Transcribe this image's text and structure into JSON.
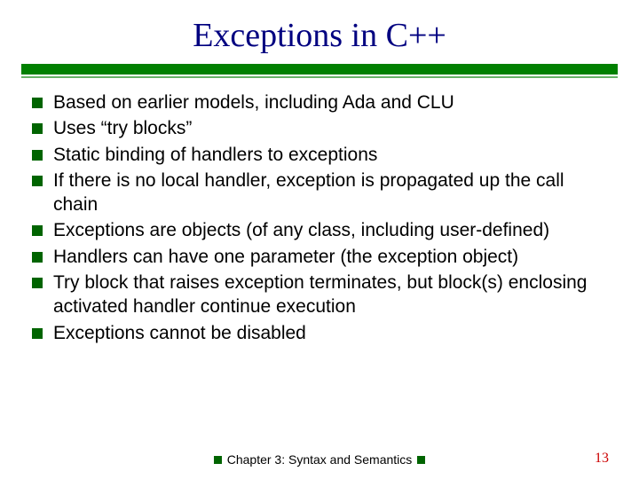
{
  "title": "Exceptions in C++",
  "bullets": [
    "Based on earlier models, including Ada and CLU",
    "Uses “try blocks”",
    "Static binding of handlers to exceptions",
    "If there is no local handler, exception is propagated up the call chain",
    "Exceptions are objects (of any class, including user-defined)",
    "Handlers can have one parameter (the exception object)",
    "Try block that raises exception terminates, but block(s) enclosing activated handler continue execution",
    "Exceptions cannot be disabled"
  ],
  "footer": "Chapter 3: Syntax and Semantics",
  "page": "13"
}
